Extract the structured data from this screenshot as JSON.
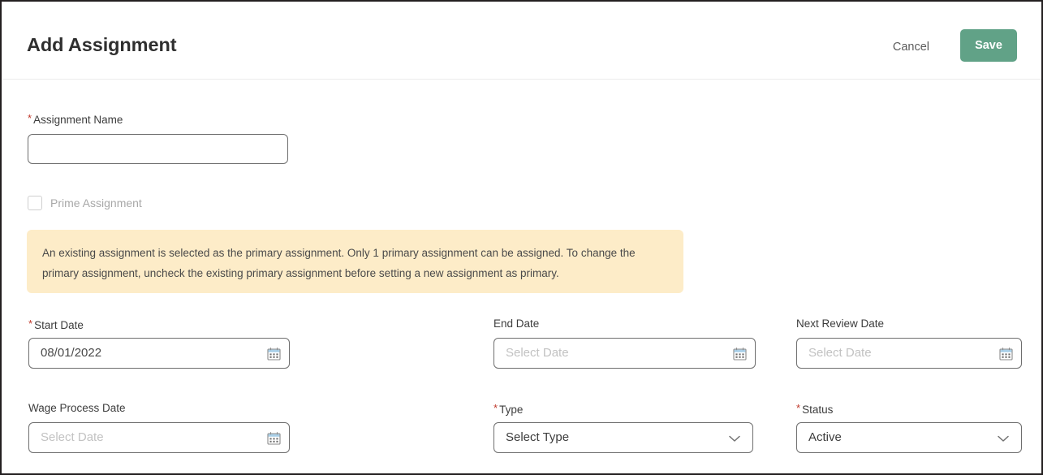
{
  "header": {
    "title": "Add Assignment",
    "cancel_label": "Cancel",
    "save_label": "Save",
    "save_color": "#61a287"
  },
  "form": {
    "required_marker": "*",
    "assignment_name": {
      "label": "Assignment Name",
      "required": true,
      "value": "",
      "placeholder": ""
    },
    "prime_assignment": {
      "label": "Prime Assignment",
      "checked": false,
      "disabled": true
    },
    "warning": {
      "text": "An existing assignment is selected as the primary assignment. Only 1 primary assignment can be assigned. To change the primary assignment, uncheck the existing primary assignment before setting a new assignment as primary.",
      "background": "#fdecc8"
    },
    "fields": {
      "start_date": {
        "label": "Start Date",
        "required": true,
        "value": "08/01/2022",
        "icon": "calendar-icon"
      },
      "end_date": {
        "label": "End Date",
        "required": false,
        "value": "Select Date",
        "icon": "calendar-icon"
      },
      "next_review_date": {
        "label": "Next Review Date",
        "required": false,
        "value": "Select Date",
        "icon": "calendar-icon"
      },
      "wage_process_date": {
        "label": "Wage Process Date",
        "required": false,
        "value": "Select Date",
        "icon": "calendar-icon"
      },
      "type": {
        "label": "Type",
        "required": true,
        "value": "Select Type",
        "icon": "chevron-down-icon"
      },
      "status": {
        "label": "Status",
        "required": true,
        "value": "Active",
        "icon": "chevron-down-icon"
      }
    }
  }
}
